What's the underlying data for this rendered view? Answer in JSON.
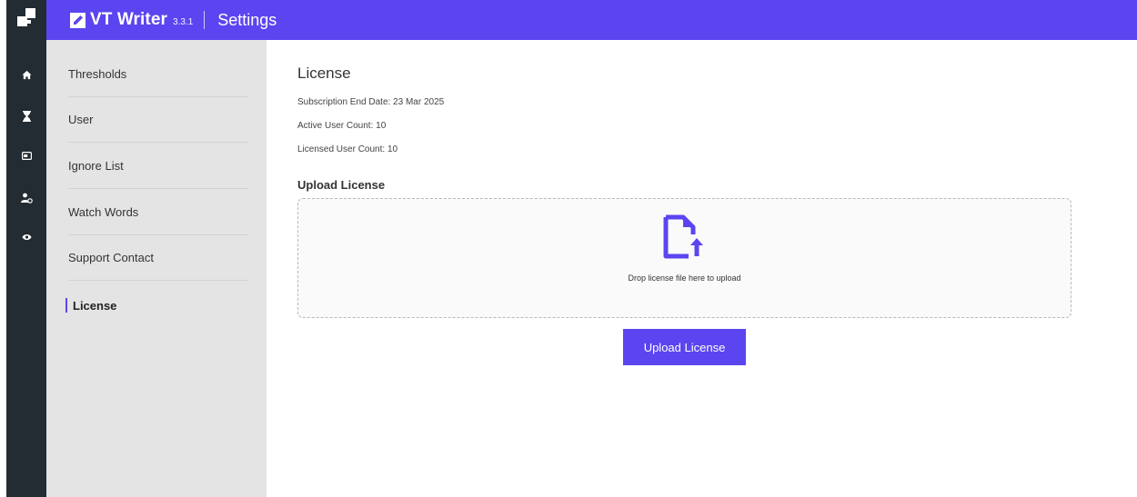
{
  "rail": {
    "icons": [
      "home-icon",
      "hourglass-icon",
      "card-icon",
      "user-settings-icon",
      "eye-icon"
    ]
  },
  "header": {
    "app_name": "VT Writer",
    "version": "3.3.1",
    "page_title": "Settings"
  },
  "menu": {
    "items": [
      {
        "label": "Thresholds"
      },
      {
        "label": "User"
      },
      {
        "label": "Ignore List"
      },
      {
        "label": "Watch Words"
      },
      {
        "label": "Support Contact"
      },
      {
        "label": "License",
        "active": true
      }
    ]
  },
  "license": {
    "title": "License",
    "subscription_end": "Subscription End Date: 23 Mar 2025",
    "active_users": "Active User Count: 10",
    "licensed_users": "Licensed User Count: 10",
    "upload_heading": "Upload License",
    "drop_text": "Drop license file here to upload",
    "upload_button": "Upload License"
  },
  "colors": {
    "accent": "#5b45f0",
    "rail": "#232b33",
    "menu_bg": "#e4e4e4"
  }
}
